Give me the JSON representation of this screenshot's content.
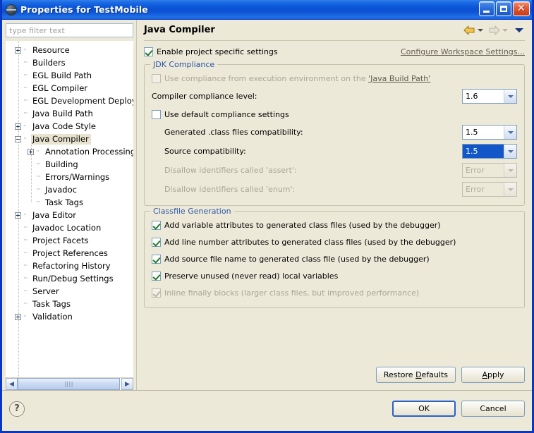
{
  "window": {
    "title": "Properties for TestMobile",
    "icon": "globe-icon",
    "minimize_label": "Minimize",
    "maximize_label": "Maximize",
    "close_label": "Close"
  },
  "colors": {
    "titlebar": "#0A54D6",
    "window_border": "#0A36C4",
    "panel_background": "#ECE9D8",
    "group_label": "#2D56A8",
    "selection": "#1256C8",
    "tree_selection": "#E8E3CF",
    "checkbox_check": "#1D7A25",
    "close_button": "#C63A18"
  },
  "filter": {
    "placeholder": "type filter text",
    "value": ""
  },
  "tree": {
    "items": [
      {
        "label": "Resource",
        "indent": 0,
        "expander": "plus",
        "selected": false
      },
      {
        "label": "Builders",
        "indent": 0,
        "expander": "none",
        "selected": false
      },
      {
        "label": "EGL Build Path",
        "indent": 0,
        "expander": "none",
        "selected": false
      },
      {
        "label": "EGL Compiler",
        "indent": 0,
        "expander": "none",
        "selected": false
      },
      {
        "label": "EGL Development Deployment",
        "indent": 0,
        "expander": "none",
        "selected": false
      },
      {
        "label": "Java Build Path",
        "indent": 0,
        "expander": "none",
        "selected": false
      },
      {
        "label": "Java Code Style",
        "indent": 0,
        "expander": "plus",
        "selected": false
      },
      {
        "label": "Java Compiler",
        "indent": 0,
        "expander": "minus",
        "selected": true
      },
      {
        "label": "Annotation Processing",
        "indent": 1,
        "expander": "plus",
        "selected": false
      },
      {
        "label": "Building",
        "indent": 1,
        "expander": "none",
        "selected": false
      },
      {
        "label": "Errors/Warnings",
        "indent": 1,
        "expander": "none",
        "selected": false
      },
      {
        "label": "Javadoc",
        "indent": 1,
        "expander": "none",
        "selected": false
      },
      {
        "label": "Task Tags",
        "indent": 1,
        "expander": "none",
        "selected": false
      },
      {
        "label": "Java Editor",
        "indent": 0,
        "expander": "plus",
        "selected": false
      },
      {
        "label": "Javadoc Location",
        "indent": 0,
        "expander": "none",
        "selected": false
      },
      {
        "label": "Project Facets",
        "indent": 0,
        "expander": "none",
        "selected": false
      },
      {
        "label": "Project References",
        "indent": 0,
        "expander": "none",
        "selected": false
      },
      {
        "label": "Refactoring History",
        "indent": 0,
        "expander": "none",
        "selected": false
      },
      {
        "label": "Run/Debug Settings",
        "indent": 0,
        "expander": "none",
        "selected": false
      },
      {
        "label": "Server",
        "indent": 0,
        "expander": "none",
        "selected": false
      },
      {
        "label": "Task Tags",
        "indent": 0,
        "expander": "none",
        "selected": false
      },
      {
        "label": "Validation",
        "indent": 0,
        "expander": "plus",
        "selected": false
      }
    ],
    "scrollbar": {
      "left_arrow": "◀",
      "right_arrow": "▶",
      "grip": "||||"
    }
  },
  "page": {
    "title": "Java Compiler",
    "nav": {
      "back_icon": "back-arrow-icon",
      "forward_icon": "forward-arrow-icon",
      "menu_icon": "chevron-down-icon"
    },
    "enable_project_specific": {
      "label": "Enable project specific settings",
      "checked": true
    },
    "configure_workspace_link": "Configure Workspace Settings..."
  },
  "jdk_compliance": {
    "title": "JDK Compliance",
    "use_execution_environment": {
      "label_prefix": "Use compliance from execution environment on the ",
      "label_link": "'Java Build Path'",
      "checked": false,
      "enabled": false
    },
    "compiler_compliance_level": {
      "label": "Compiler compliance level:",
      "value": "1.6",
      "enabled": true,
      "focused": false
    },
    "use_default_compliance": {
      "label": "Use default compliance settings",
      "checked": false,
      "enabled": true
    },
    "class_files_compatibility": {
      "label": "Generated .class files compatibility:",
      "value": "1.5",
      "enabled": true,
      "focused": false
    },
    "source_compatibility": {
      "label": "Source compatibility:",
      "value": "1.5",
      "enabled": true,
      "focused": true
    },
    "disallow_assert": {
      "label": "Disallow identifiers called 'assert':",
      "value": "Error",
      "enabled": false,
      "focused": false
    },
    "disallow_enum": {
      "label": "Disallow identifiers called 'enum':",
      "value": "Error",
      "enabled": false,
      "focused": false
    }
  },
  "classfile_generation": {
    "title": "Classfile Generation",
    "options": [
      {
        "label": "Add variable attributes to generated class files (used by the debugger)",
        "checked": true,
        "enabled": true
      },
      {
        "label": "Add line number attributes to generated class files (used by the debugger)",
        "checked": true,
        "enabled": true
      },
      {
        "label": "Add source file name to generated class file (used by the debugger)",
        "checked": true,
        "enabled": true
      },
      {
        "label": "Preserve unused (never read) local variables",
        "checked": true,
        "enabled": true
      },
      {
        "label": "Inline finally blocks (larger class files, but improved performance)",
        "checked": true,
        "enabled": false
      }
    ]
  },
  "actions": {
    "restore_defaults": "Restore Defaults",
    "apply": "Apply"
  },
  "footer": {
    "help_icon": "help-icon",
    "help_glyph": "?",
    "ok": "OK",
    "cancel": "Cancel",
    "default_button": "OK"
  }
}
